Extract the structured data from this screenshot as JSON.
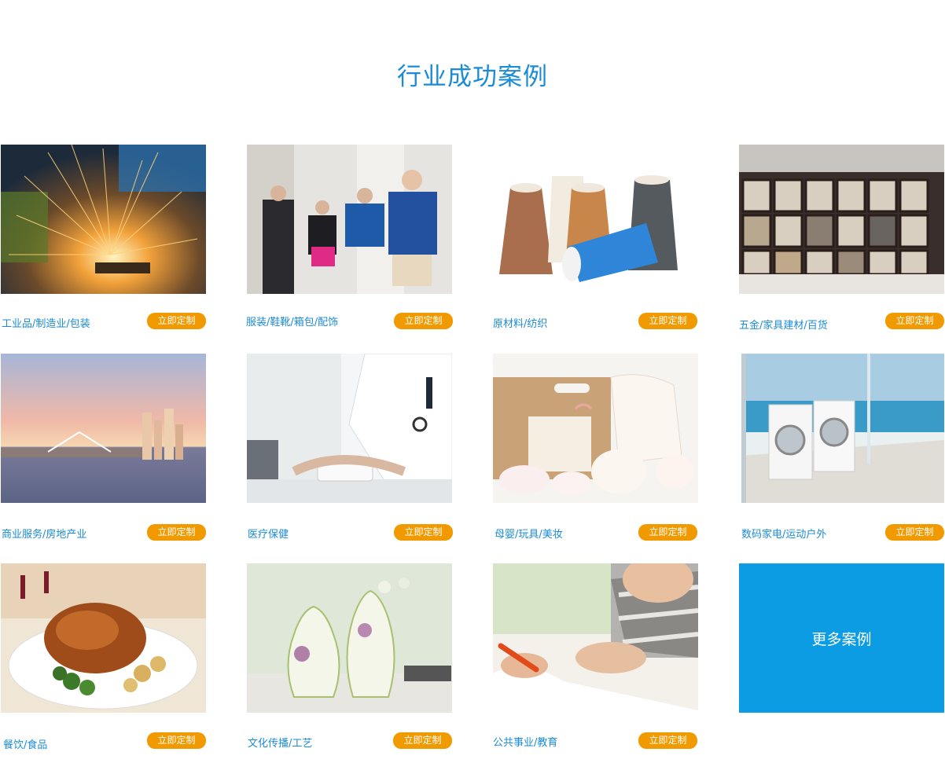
{
  "section": {
    "title": "行业成功案例",
    "more_label": "更多案例",
    "button_color": "#f09a00",
    "accent_color": "#1a8bd6",
    "more_color": "#0b9ce3"
  },
  "cases": [
    {
      "name": "工业品/制造业/包装",
      "button": "立即定制",
      "image": "welding-sparks-image"
    },
    {
      "name": "服装/鞋靴/箱包/配饰",
      "button": "立即定制",
      "image": "fashion-models-image"
    },
    {
      "name": "原材料/纺织",
      "button": "立即定制",
      "image": "thread-spools-image"
    },
    {
      "name": "五金/家具建材/百货",
      "button": "立即定制",
      "image": "tile-showroom-image"
    },
    {
      "name": "商业服务/房地产业",
      "button": "立即定制",
      "image": "city-skyline-image"
    },
    {
      "name": "医疗保健",
      "button": "立即定制",
      "image": "doctor-blood-pressure-image"
    },
    {
      "name": "母婴/玩具/美妆",
      "button": "立即定制",
      "image": "baby-clothes-gift-image"
    },
    {
      "name": "数码家电/运动户外",
      "button": "立即定制",
      "image": "washing-machines-image"
    },
    {
      "name": "餐饮/食品",
      "button": "立即定制",
      "image": "roast-chicken-image"
    },
    {
      "name": "文化传播/工艺",
      "button": "立即定制",
      "image": "ceramic-vases-image"
    },
    {
      "name": "公共事业/教育",
      "button": "立即定制",
      "image": "child-drawing-image"
    }
  ]
}
